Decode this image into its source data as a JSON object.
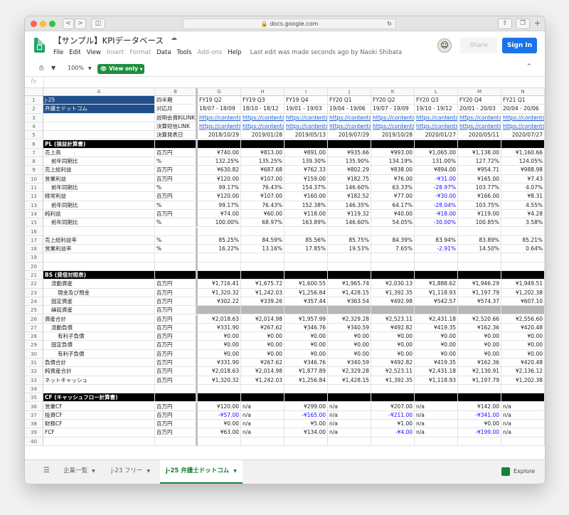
{
  "browser": {
    "url": "docs.google.com",
    "nav_back": "<",
    "nav_forward": ">",
    "sidebar_icon": "sidebar-icon",
    "reload_icon": "reload-icon",
    "share_icon": "share-icon",
    "tabs_icon": "tabs-icon",
    "new_tab_icon": "+"
  },
  "app": {
    "title": "【サンプル】KPIデータベース",
    "cloud_icon": "cloud-icon",
    "menu": [
      "File",
      "Edit",
      "View",
      "Insert",
      "Format",
      "Data",
      "Tools",
      "Add-ons",
      "Help"
    ],
    "last_edit": "Last edit was made seconds ago by Naoki Shibata",
    "share_label": "Share",
    "signin_label": "Sign In"
  },
  "toolbar": {
    "print_icon": "print-icon",
    "filter_icon": "filter-icon",
    "zoom": "100%",
    "view_only_label": "View only",
    "collapse_icon": "chevron-up-icon"
  },
  "formula_bar": {
    "fx_label": "fx",
    "value": ""
  },
  "grid": {
    "columns": [
      "A",
      "B",
      "G",
      "H",
      "I",
      "J",
      "K",
      "L",
      "M",
      "N"
    ],
    "rows": [
      {
        "n": "1",
        "cells": [
          "j-25",
          "四半期",
          "FY19 Q2",
          "FY19 Q3",
          "FY19 Q4",
          "FY20 Q1",
          "FY20 Q2",
          "FY20 Q3",
          "FY20 Q4",
          "FY21 Q1"
        ],
        "style": "period"
      },
      {
        "n": "2",
        "cells": [
          "弁護士ドットコム",
          "対応月",
          "18/07 - 18/09",
          "18/10 - 18/12",
          "19/01 - 19/03",
          "19/04 - 19/06",
          "19/07 - 19/09",
          "19/10 - 19/12",
          "20/01 - 20/03",
          "20/04 - 20/06"
        ],
        "style": "period"
      },
      {
        "n": "3",
        "cells": [
          "",
          "説明会資料LINK",
          "https://contents.x",
          "https://contents.x",
          "https://contents.x",
          "https://contents.x",
          "https://contents.x",
          "https://contents.x",
          "https://contents.x",
          "https://contents"
        ],
        "style": "link"
      },
      {
        "n": "4",
        "cells": [
          "",
          "決算短信LINK",
          "https://contents.x",
          "https://contents.x",
          "https://contents.x",
          "https://contents.x",
          "https://contents.x",
          "https://contents.x",
          "https://contents.x",
          "https://contents"
        ],
        "style": "link"
      },
      {
        "n": "5",
        "cells": [
          "",
          "決算発表日",
          "2018/10/29",
          "2019/01/28",
          "2019/05/13",
          "2019/07/29",
          "2019/10/28",
          "2020/01/27",
          "2020/05/11",
          "2020/07/27"
        ],
        "style": "date"
      },
      {
        "n": "6",
        "cells": [
          "PL (損益計算書)",
          "",
          "",
          "",
          "",
          "",
          "",
          "",
          "",
          ""
        ],
        "style": "section"
      },
      {
        "n": "7",
        "cells": [
          "売上高",
          "百万円",
          "¥740.00",
          "¥813.00",
          "¥891.00",
          "¥935.66",
          "¥993.00",
          "¥1,065.00",
          "¥1,138.00",
          "¥1,160.66"
        ],
        "style": "num"
      },
      {
        "n": "8",
        "cells": [
          "前年同期比",
          "%",
          "132.25%",
          "135.25%",
          "139.30%",
          "135.90%",
          "134.19%",
          "131.00%",
          "127.72%",
          "124.05%"
        ],
        "style": "num",
        "indent": 1
      },
      {
        "n": "9",
        "cells": [
          "売上総利益",
          "百万円",
          "¥630.82",
          "¥687.68",
          "¥762.33",
          "¥802.29",
          "¥838.00",
          "¥894.00",
          "¥954.71",
          "¥988.98"
        ],
        "style": "num"
      },
      {
        "n": "10",
        "cells": [
          "営業利益",
          "百万円",
          "¥120.00",
          "¥107.00",
          "¥159.00",
          "¥182.75",
          "¥76.00",
          "-¥31.00",
          "¥165.00",
          "¥7.43"
        ],
        "style": "num"
      },
      {
        "n": "11",
        "cells": [
          "前年同期比",
          "%",
          "99.17%",
          "76.43%",
          "154.37%",
          "146.60%",
          "63.33%",
          "-28.97%",
          "103.77%",
          "4.07%"
        ],
        "style": "num",
        "indent": 1
      },
      {
        "n": "12",
        "cells": [
          "経常利益",
          "百万円",
          "¥120.00",
          "¥107.00",
          "¥160.00",
          "¥182.52",
          "¥77.00",
          "-¥30.00",
          "¥166.00",
          "¥8.31"
        ],
        "style": "num"
      },
      {
        "n": "13",
        "cells": [
          "前年同期比",
          "%",
          "99.17%",
          "76.43%",
          "152.38%",
          "146.35%",
          "64.17%",
          "-28.04%",
          "103.75%",
          "4.55%"
        ],
        "style": "num",
        "indent": 1
      },
      {
        "n": "14",
        "cells": [
          "純利益",
          "百万円",
          "¥74.00",
          "¥60.00",
          "¥118.00",
          "¥119.32",
          "¥40.00",
          "-¥18.00",
          "¥119.00",
          "¥4.28"
        ],
        "style": "num"
      },
      {
        "n": "15",
        "cells": [
          "前年同期比",
          "%",
          "100.00%",
          "68.97%",
          "163.89%",
          "146.60%",
          "54.05%",
          "-30.00%",
          "100.85%",
          "3.58%"
        ],
        "style": "num",
        "indent": 1
      },
      {
        "n": "16",
        "cells": [
          "",
          "",
          "",
          "",
          "",
          "",
          "",
          "",
          "",
          ""
        ],
        "style": "num"
      },
      {
        "n": "17",
        "cells": [
          "売上総利益率",
          "%",
          "85.25%",
          "84.59%",
          "85.56%",
          "85.75%",
          "84.39%",
          "83.94%",
          "83.89%",
          "85.21%"
        ],
        "style": "num"
      },
      {
        "n": "18",
        "cells": [
          "営業利益率",
          "%",
          "16.22%",
          "13.16%",
          "17.85%",
          "19.53%",
          "7.65%",
          "-2.91%",
          "14.50%",
          "0.64%"
        ],
        "style": "num"
      },
      {
        "n": "19",
        "cells": [
          "",
          "",
          "",
          "",
          "",
          "",
          "",
          "",
          "",
          ""
        ],
        "style": "num"
      },
      {
        "n": "20",
        "cells": [
          "",
          "",
          "",
          "",
          "",
          "",
          "",
          "",
          "",
          ""
        ],
        "style": "num"
      },
      {
        "n": "21",
        "cells": [
          "BS (貸借対照表)",
          "",
          "",
          "",
          "",
          "",
          "",
          "",
          "",
          ""
        ],
        "style": "section"
      },
      {
        "n": "22",
        "cells": [
          "流動資産",
          "百万円",
          "¥1,716.41",
          "¥1,675.72",
          "¥1,600.55",
          "¥1,965.74",
          "¥2,030.13",
          "¥1,888.62",
          "¥1,946.29",
          "¥1,949.51"
        ],
        "style": "num",
        "indent": 1
      },
      {
        "n": "23",
        "cells": [
          "現金及び預金",
          "百万円",
          "¥1,320.32",
          "¥1,242.03",
          "¥1,256.84",
          "¥1,428.15",
          "¥1,392.35",
          "¥1,118.93",
          "¥1,197.79",
          "¥1,202.38"
        ],
        "style": "num",
        "indent": 2
      },
      {
        "n": "24",
        "cells": [
          "固定資産",
          "百万円",
          "¥302.22",
          "¥339.26",
          "¥357.44",
          "¥363.54",
          "¥492.98",
          "¥542.57",
          "¥574.37",
          "¥607.10"
        ],
        "style": "num",
        "indent": 1
      },
      {
        "n": "25",
        "cells": [
          "繰延資産",
          "百万円",
          "",
          "",
          "",
          "",
          "",
          "",
          "",
          ""
        ],
        "style": "gray",
        "indent": 1
      },
      {
        "n": "26",
        "cells": [
          "資産合計",
          "百万円",
          "¥2,018.63",
          "¥2,014.98",
          "¥1,957.99",
          "¥2,329.28",
          "¥2,523.11",
          "¥2,431.18",
          "¥2,520.66",
          "¥2,556.60"
        ],
        "style": "num"
      },
      {
        "n": "27",
        "cells": [
          "流動負債",
          "百万円",
          "¥331.90",
          "¥267.62",
          "¥346.76",
          "¥340.59",
          "¥492.82",
          "¥419.35",
          "¥162.36",
          "¥420.48"
        ],
        "style": "num",
        "indent": 1
      },
      {
        "n": "28",
        "cells": [
          "有利子負債",
          "百万円",
          "¥0.00",
          "¥0.00",
          "¥0.00",
          "¥0.00",
          "¥0.00",
          "¥0.00",
          "¥0.00",
          "¥0.00"
        ],
        "style": "num",
        "indent": 2
      },
      {
        "n": "29",
        "cells": [
          "固定負債",
          "百万円",
          "¥0.00",
          "¥0.00",
          "¥0.00",
          "¥0.00",
          "¥0.00",
          "¥0.00",
          "¥0.00",
          "¥0.00"
        ],
        "style": "num",
        "indent": 1
      },
      {
        "n": "30",
        "cells": [
          "有利子負債",
          "百万円",
          "¥0.00",
          "¥0.00",
          "¥0.00",
          "¥0.00",
          "¥0.00",
          "¥0.00",
          "¥0.00",
          "¥0.00"
        ],
        "style": "num",
        "indent": 2
      },
      {
        "n": "31",
        "cells": [
          "負債合計",
          "百万円",
          "¥331.90",
          "¥267.62",
          "¥346.76",
          "¥340.59",
          "¥492.82",
          "¥419.35",
          "¥162.36",
          "¥420.48"
        ],
        "style": "num"
      },
      {
        "n": "32",
        "cells": [
          "純資産合計",
          "百万円",
          "¥2,018.63",
          "¥2,014.98",
          "¥1,877.89",
          "¥2,329.28",
          "¥2,523.11",
          "¥2,431.18",
          "¥2,130.91",
          "¥2,136.12"
        ],
        "style": "num"
      },
      {
        "n": "33",
        "cells": [
          "ネットキャッシュ",
          "百万円",
          "¥1,320.32",
          "¥1,242.03",
          "¥1,256.84",
          "¥1,428.15",
          "¥1,392.35",
          "¥1,118.93",
          "¥1,197.79",
          "¥1,202.38"
        ],
        "style": "num"
      },
      {
        "n": "34",
        "cells": [
          "",
          "",
          "",
          "",
          "",
          "",
          "",
          "",
          "",
          ""
        ],
        "style": "num"
      },
      {
        "n": "35",
        "cells": [
          "CF (キャッシュフロー計算書)",
          "",
          "",
          "",
          "",
          "",
          "",
          "",
          "",
          ""
        ],
        "style": "section"
      },
      {
        "n": "36",
        "cells": [
          "営業CF",
          "百万円",
          "¥120.00",
          "n/a",
          "¥299.00",
          "n/a",
          "¥207.00",
          "n/a",
          "¥142.00",
          "n/a"
        ],
        "style": "cf"
      },
      {
        "n": "37",
        "cells": [
          "投資CF",
          "百万円",
          "-¥57.00",
          "n/a",
          "-¥165.00",
          "n/a",
          "-¥211.00",
          "n/a",
          "-¥341.00",
          "n/a"
        ],
        "style": "cf"
      },
      {
        "n": "38",
        "cells": [
          "財務CF",
          "百万円",
          "¥0.00",
          "n/a",
          "¥5.00",
          "n/a",
          "¥1.00",
          "n/a",
          "¥0.00",
          "n/a"
        ],
        "style": "cf"
      },
      {
        "n": "39",
        "cells": [
          "FCF",
          "百万円",
          "¥63.00",
          "n/a",
          "¥134.00",
          "n/a",
          "-¥4.00",
          "n/a",
          "-¥199.00",
          "n/a"
        ],
        "style": "cf"
      },
      {
        "n": "40",
        "cells": [
          "",
          "",
          "",
          "",
          "",
          "",
          "",
          "",
          "",
          ""
        ],
        "style": "num"
      }
    ]
  },
  "sheet_tabs": {
    "all_sheets_icon": "sheets-list-icon",
    "tabs": [
      {
        "label": "企業一覧",
        "active": false
      },
      {
        "label": "j-23 フリー",
        "active": false
      },
      {
        "label": "j-25 弁護士ドットコム",
        "active": true
      }
    ],
    "explore_label": "Explore"
  },
  "colors": {
    "accent_green": "#188038",
    "signin_blue": "#1a73e8",
    "header_blue": "#1f4e8c",
    "negative_blue": "#1a0dff",
    "link_blue": "#1155cc",
    "section_black": "#000000",
    "gray_row": "#b7b7b7"
  }
}
